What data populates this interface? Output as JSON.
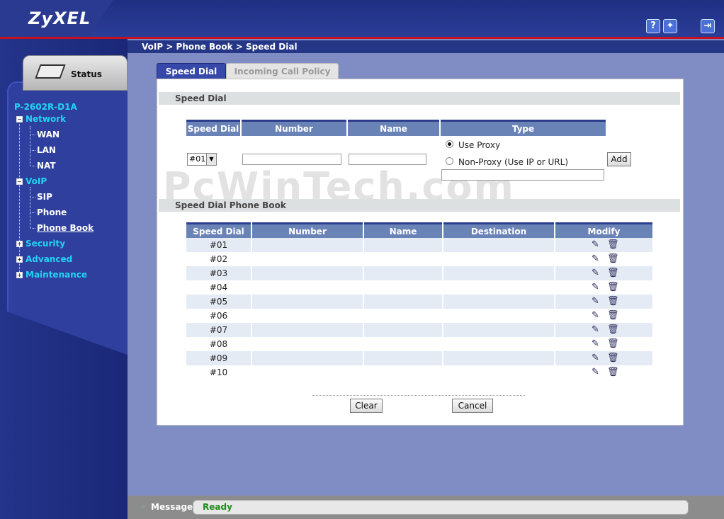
{
  "app": {
    "logo": "ZyXEL",
    "model": "P-2602R-D1A"
  },
  "header": {
    "help_icon": "help-icon",
    "wizard_icon": "wizard-icon",
    "logout_icon": "logout-icon"
  },
  "sidebar": {
    "status_tab": "Status",
    "items": [
      {
        "label": "Network",
        "expander": "−"
      },
      {
        "label": "WAN"
      },
      {
        "label": "LAN"
      },
      {
        "label": "NAT"
      },
      {
        "label": "VoIP",
        "expander": "−"
      },
      {
        "label": "SIP"
      },
      {
        "label": "Phone"
      },
      {
        "label": "Phone Book"
      },
      {
        "label": "Security",
        "expander": "+"
      },
      {
        "label": "Advanced",
        "expander": "+"
      },
      {
        "label": "Maintenance",
        "expander": "+"
      }
    ]
  },
  "breadcrumb": "VoIP > Phone Book > Speed Dial",
  "tabs": [
    {
      "label": "Speed Dial",
      "active": true
    },
    {
      "label": "Incoming Call Policy",
      "active": false
    }
  ],
  "speed_dial_form": {
    "section_title": "Speed Dial",
    "headers": [
      "Speed Dial",
      "Number",
      "Name",
      "Type"
    ],
    "selected_index": "#01",
    "number_value": "",
    "name_value": "",
    "proxy_option": "Use Proxy",
    "nonproxy_option": "Non-Proxy (Use IP or URL)",
    "nonproxy_value": "",
    "add_button": "Add"
  },
  "phone_book": {
    "section_title": "Speed Dial Phone Book",
    "headers": [
      "Speed Dial",
      "Number",
      "Name",
      "Destination",
      "Modify"
    ],
    "rows": [
      {
        "index": "#01",
        "number": "",
        "name": "",
        "destination": ""
      },
      {
        "index": "#02",
        "number": "",
        "name": "",
        "destination": ""
      },
      {
        "index": "#03",
        "number": "",
        "name": "",
        "destination": ""
      },
      {
        "index": "#04",
        "number": "",
        "name": "",
        "destination": ""
      },
      {
        "index": "#05",
        "number": "",
        "name": "",
        "destination": ""
      },
      {
        "index": "#06",
        "number": "",
        "name": "",
        "destination": ""
      },
      {
        "index": "#07",
        "number": "",
        "name": "",
        "destination": ""
      },
      {
        "index": "#08",
        "number": "",
        "name": "",
        "destination": ""
      },
      {
        "index": "#09",
        "number": "",
        "name": "",
        "destination": ""
      },
      {
        "index": "#10",
        "number": "",
        "name": "",
        "destination": ""
      }
    ]
  },
  "buttons": {
    "clear": "Clear",
    "cancel": "Cancel"
  },
  "watermark": "PcWinTech.com",
  "status_bar": {
    "label": "Message",
    "text": "Ready",
    "text_color": "#1e8c1e"
  }
}
